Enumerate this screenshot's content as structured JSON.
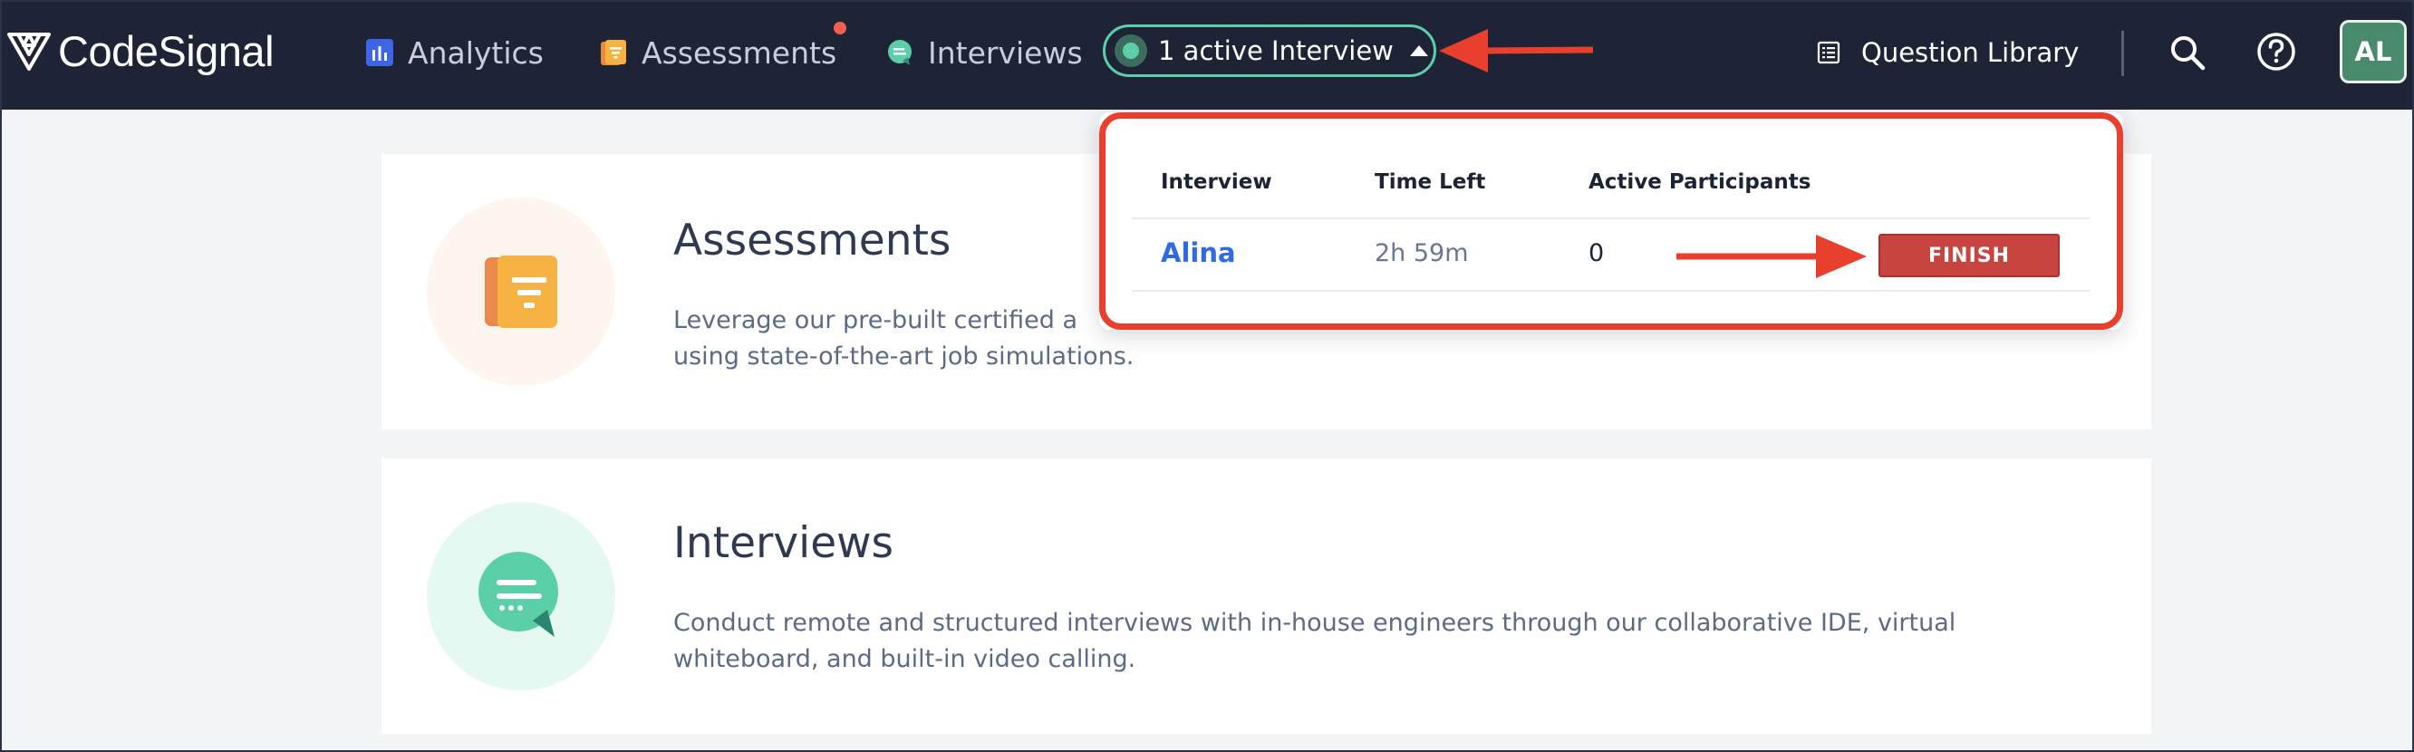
{
  "app": {
    "logo_text": "CodeSignal"
  },
  "nav": {
    "analytics": "Analytics",
    "assessments": "Assessments",
    "interviews": "Interviews",
    "active_interview": "1 active Interview",
    "question_library": "Question Library",
    "avatar_initials": "AL"
  },
  "icons": {
    "analytics": "bar-chart-icon",
    "assessments": "document-icon",
    "interviews": "chat-icon",
    "question_library": "list-icon",
    "search": "search-icon",
    "help": "help-icon"
  },
  "colors": {
    "topbar": "#1e2436",
    "accent_green": "#5bd0a8",
    "notification": "#f0614f",
    "finish": "#c8453f",
    "link_blue": "#2f6ae6",
    "annotation_red": "#e8402c"
  },
  "dropdown": {
    "headers": [
      "Interview",
      "Time Left",
      "Active Participants"
    ],
    "rows": [
      {
        "name": "Alina",
        "time_left": "2h 59m",
        "participants": "0",
        "action": "FINISH"
      }
    ]
  },
  "cards": [
    {
      "title": "Assessments",
      "description": "Leverage our pre-built certified a"
    },
    {
      "title": "Interviews",
      "description": "Conduct remote and structured interviews with in-house engineers through our collaborative IDE, virtual whiteboard, and built-in video calling."
    }
  ],
  "cards_extra": {
    "assessments_desc_line2": "using state-of-the-art job simulations."
  }
}
